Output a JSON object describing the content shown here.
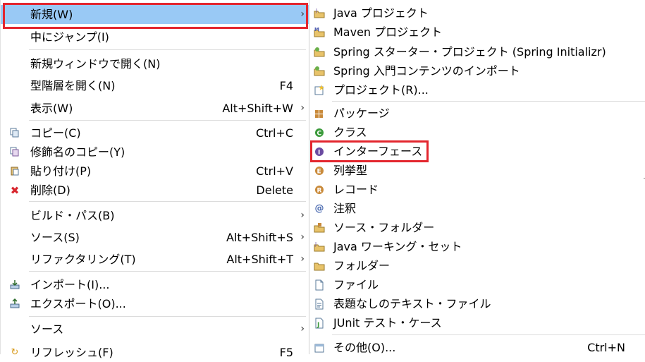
{
  "context_menu": {
    "items": [
      {
        "label": "新規(W)",
        "shortcut": "",
        "has_submenu": true,
        "icon": "",
        "highlighted": true
      },
      {
        "label": "中にジャンプ(I)",
        "shortcut": "",
        "has_submenu": false,
        "icon": ""
      },
      {
        "label": "新規ウィンドウで開く(N)",
        "shortcut": "",
        "has_submenu": false,
        "icon": ""
      },
      {
        "label": "型階層を開く(N)",
        "shortcut": "F4",
        "has_submenu": false,
        "icon": ""
      },
      {
        "label": "表示(W)",
        "shortcut": "Alt+Shift+W",
        "has_submenu": true,
        "icon": ""
      },
      {
        "label": "コピー(C)",
        "shortcut": "Ctrl+C",
        "has_submenu": false,
        "icon": "copy-icon"
      },
      {
        "label": "修飾名のコピー(Y)",
        "shortcut": "",
        "has_submenu": false,
        "icon": "copy-qualified-icon"
      },
      {
        "label": "貼り付け(P)",
        "shortcut": "Ctrl+V",
        "has_submenu": false,
        "icon": "paste-icon"
      },
      {
        "label": "削除(D)",
        "shortcut": "Delete",
        "has_submenu": false,
        "icon": "delete-icon"
      },
      {
        "label": "ビルド・パス(B)",
        "shortcut": "",
        "has_submenu": true,
        "icon": ""
      },
      {
        "label": "ソース(S)",
        "shortcut": "Alt+Shift+S",
        "has_submenu": true,
        "icon": ""
      },
      {
        "label": "リファクタリング(T)",
        "shortcut": "Alt+Shift+T",
        "has_submenu": true,
        "icon": ""
      },
      {
        "label": "インポート(I)...",
        "shortcut": "",
        "has_submenu": false,
        "icon": "import-icon"
      },
      {
        "label": "エクスポート(O)...",
        "shortcut": "",
        "has_submenu": false,
        "icon": "export-icon"
      },
      {
        "label": "ソース",
        "shortcut": "",
        "has_submenu": true,
        "icon": ""
      },
      {
        "label": "リフレッシュ(F)",
        "shortcut": "F5",
        "has_submenu": false,
        "icon": "refresh-icon"
      }
    ]
  },
  "submenu": {
    "items": [
      {
        "label": "Java プロジェクト",
        "shortcut": "",
        "icon": "java-project-icon"
      },
      {
        "label": "Maven プロジェクト",
        "shortcut": "",
        "icon": "maven-project-icon"
      },
      {
        "label": "Spring スターター・プロジェクト (Spring Initializr)",
        "shortcut": "",
        "icon": "spring-starter-icon"
      },
      {
        "label": "Spring 入門コンテンツのインポート",
        "shortcut": "",
        "icon": "spring-import-icon"
      },
      {
        "label": "プロジェクト(R)...",
        "shortcut": "",
        "icon": "project-icon"
      },
      {
        "label": "パッケージ",
        "shortcut": "",
        "icon": "package-icon"
      },
      {
        "label": "クラス",
        "shortcut": "",
        "icon": "class-icon"
      },
      {
        "label": "インターフェース",
        "shortcut": "",
        "icon": "interface-icon",
        "emphasized": true
      },
      {
        "label": "列挙型",
        "shortcut": "",
        "icon": "enum-icon"
      },
      {
        "label": "レコード",
        "shortcut": "",
        "icon": "record-icon"
      },
      {
        "label": "注釈",
        "shortcut": "",
        "icon": "annotation-icon"
      },
      {
        "label": "ソース・フォルダー",
        "shortcut": "",
        "icon": "source-folder-icon"
      },
      {
        "label": "Java ワーキング・セット",
        "shortcut": "",
        "icon": "working-set-icon"
      },
      {
        "label": "フォルダー",
        "shortcut": "",
        "icon": "folder-icon"
      },
      {
        "label": "ファイル",
        "shortcut": "",
        "icon": "file-icon"
      },
      {
        "label": "表題なしのテキスト・ファイル",
        "shortcut": "",
        "icon": "untitled-text-file-icon"
      },
      {
        "label": "JUnit テスト・ケース",
        "shortcut": "",
        "icon": "junit-test-case-icon"
      },
      {
        "label": "その他(O)...",
        "shortcut": "Ctrl+N",
        "icon": "other-wizard-icon"
      }
    ]
  },
  "colors": {
    "highlight": "#99c9f5",
    "emphasis_box": "#e3262e",
    "separator": "#dcdcdc"
  }
}
